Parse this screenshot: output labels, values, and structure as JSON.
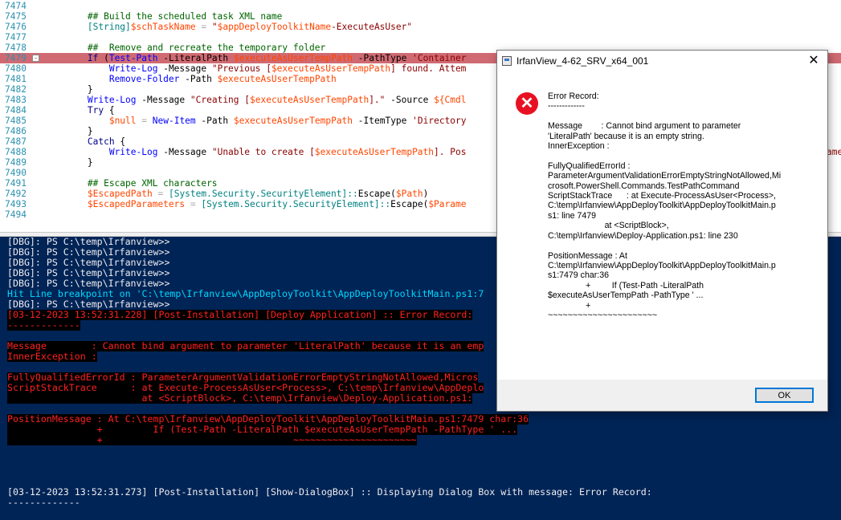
{
  "editor": {
    "lines": [
      {
        "num": "7474",
        "text": ""
      },
      {
        "num": "7475",
        "text": "        ## Build the scheduled task XML name"
      },
      {
        "num": "7476",
        "text": "        [String]$schTaskName = \"$appDeployToolkitName-ExecuteAsUser\""
      },
      {
        "num": "7477",
        "text": ""
      },
      {
        "num": "7478",
        "text": "        ##  Remove and recreate the temporary folder"
      },
      {
        "num": "7479",
        "text": "        If (Test-Path -LiteralPath $executeAsUserTempPath -PathType 'Container"
      },
      {
        "num": "7480",
        "text": "            Write-Log -Message \"Previous [$executeAsUserTempPath] found. Attem"
      },
      {
        "num": "7481",
        "text": "            Remove-Folder -Path $executeAsUserTempPath"
      },
      {
        "num": "7482",
        "text": "        }"
      },
      {
        "num": "7483",
        "text": "        Write-Log -Message \"Creating [$executeAsUserTempPath].\" -Source ${Cmdl"
      },
      {
        "num": "7484",
        "text": "        Try {"
      },
      {
        "num": "7485",
        "text": "            $null = New-Item -Path $executeAsUserTempPath -ItemType 'Directory"
      },
      {
        "num": "7486",
        "text": "        }"
      },
      {
        "num": "7487",
        "text": "        Catch {"
      },
      {
        "num": "7488",
        "text": "            Write-Log -Message \"Unable to create [$executeAsUserTempPath]. Pos"
      },
      {
        "num": "7489",
        "text": "        }"
      },
      {
        "num": "7490",
        "text": ""
      },
      {
        "num": "7491",
        "text": "        ## Escape XML characters"
      },
      {
        "num": "7492",
        "text": "        $EscapedPath = [System.Security.SecurityElement]::Escape($Path)"
      },
      {
        "num": "7493",
        "text": "        $EscapedParameters = [System.Security.SecurityElement]::Escape($Parame"
      },
      {
        "num": "7494",
        "text": ""
      }
    ],
    "overflow_right": "ame",
    "fold_marker": "-"
  },
  "console": {
    "lines": [
      {
        "t": "[DBG]: PS C:\\temp\\Irfanview>>",
        "s": "w"
      },
      {
        "t": "[DBG]: PS C:\\temp\\Irfanview>>",
        "s": "w"
      },
      {
        "t": "[DBG]: PS C:\\temp\\Irfanview>>",
        "s": "w"
      },
      {
        "t": "[DBG]: PS C:\\temp\\Irfanview>>",
        "s": "w"
      },
      {
        "t": "[DBG]: PS C:\\temp\\Irfanview>>",
        "s": "w"
      },
      {
        "t": "Hit Line breakpoint on 'C:\\temp\\Irfanview\\AppDeployToolkit\\AppDeployToolkitMain.ps1:7",
        "s": "cy"
      },
      {
        "t": "[DBG]: PS C:\\temp\\Irfanview>>",
        "s": "w"
      },
      {
        "t": "[03-12-2023 13:52:31.228] [Post-Installation] [Deploy Application] :: Error Record:",
        "s": "er"
      },
      {
        "t": "-------------",
        "s": "er"
      },
      {
        "t": "",
        "s": "w"
      },
      {
        "t": "Message        : Cannot bind argument to parameter 'LiteralPath' because it is an emp",
        "s": "er"
      },
      {
        "t": "InnerException :",
        "s": "er"
      },
      {
        "t": "",
        "s": "w"
      },
      {
        "t": "FullyQualifiedErrorId : ParameterArgumentValidationErrorEmptyStringNotAllowed,Micros",
        "s": "er"
      },
      {
        "t": "ScriptStackTrace      : at Execute-ProcessAsUser<Process>, C:\\temp\\Irfanview\\AppDeplo",
        "s": "er"
      },
      {
        "t": "                        at <ScriptBlock>, C:\\temp\\Irfanview\\Deploy-Application.ps1:",
        "s": "er"
      },
      {
        "t": "",
        "s": "w"
      },
      {
        "t": "PositionMessage : At C:\\temp\\Irfanview\\AppDeployToolkit\\AppDeployToolkitMain.ps1:7479 char:36",
        "s": "er"
      },
      {
        "t": "                +         If (Test-Path -LiteralPath $executeAsUserTempPath -PathType ' ...",
        "s": "er"
      },
      {
        "t": "                +                                  ~~~~~~~~~~~~~~~~~~~~~~",
        "s": "er"
      },
      {
        "t": "",
        "s": "w"
      },
      {
        "t": "",
        "s": "w"
      },
      {
        "t": "",
        "s": "w"
      },
      {
        "t": "",
        "s": "w"
      },
      {
        "t": "[03-12-2023 13:52:31.273] [Post-Installation] [Show-DialogBox] :: Displaying Dialog Box with message: Error Record:",
        "s": "w"
      },
      {
        "t": "-------------",
        "s": "w"
      }
    ]
  },
  "dialog": {
    "title": "IrfanView_4-62_SRV_x64_001",
    "close_glyph": "✕",
    "error_glyph": "✕",
    "message": "Error Record:\n-------------\n\nMessage        : Cannot bind argument to parameter\n'LiteralPath' because it is an empty string.\nInnerException :\n\nFullyQualifiedErrorId :\nParameterArgumentValidationErrorEmptyStringNotAllowed,Mi\ncrosoft.PowerShell.Commands.TestPathCommand\nScriptStackTrace      : at Execute-ProcessAsUser<Process>,\nC:\\temp\\Irfanview\\AppDeployToolkit\\AppDeployToolkitMain.p\ns1: line 7479\n                        at <ScriptBlock>,\nC:\\temp\\Irfanview\\Deploy-Application.ps1: line 230\n\nPositionMessage : At\nC:\\temp\\Irfanview\\AppDeployToolkit\\AppDeployToolkitMain.p\ns1:7479 char:36\n                +         If (Test-Path -LiteralPath\n$executeAsUserTempPath -PathType ' ...\n                +\n~~~~~~~~~~~~~~~~~~~~~~",
    "ok_label": "OK"
  },
  "colors": {
    "console_bg": "#012456",
    "error_fg": "#ff2020",
    "highlight_line": "#d06a72",
    "error_icon": "#e81123"
  }
}
